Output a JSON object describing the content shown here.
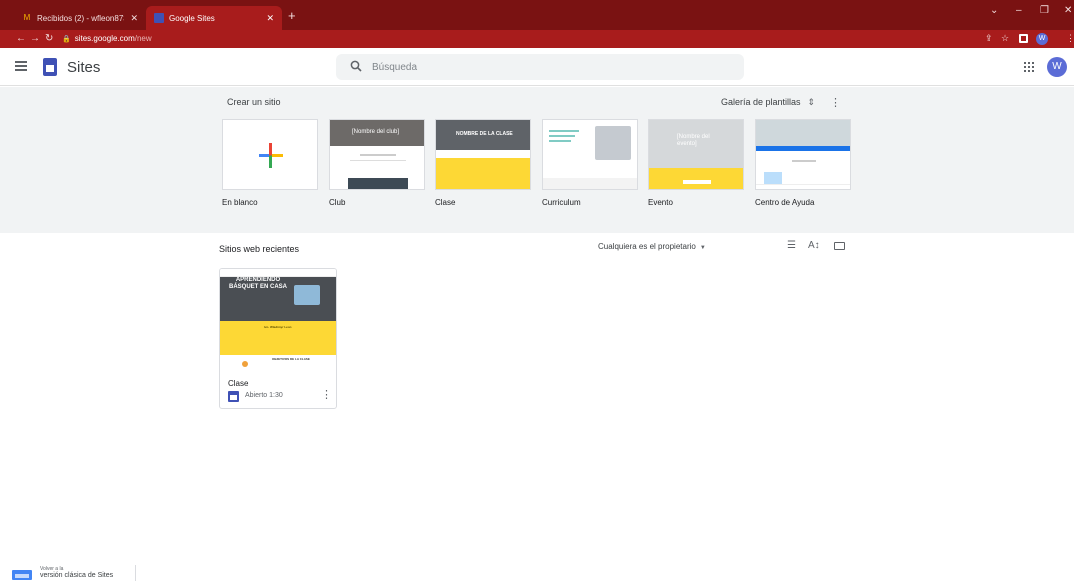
{
  "browser": {
    "tabs": [
      {
        "title": "Recibidos (2) - wfleon873@gmai",
        "icon": "gmail-icon"
      },
      {
        "title": "Google Sites",
        "icon": "sites-icon"
      }
    ],
    "url_host": "sites.google.com",
    "url_path": "/new",
    "profile_initial": "W",
    "theme_color": "#a81c1c"
  },
  "app": {
    "title": "Sites",
    "search_placeholder": "Búsqueda",
    "user_initial": "W",
    "accent": "#3f51b5"
  },
  "gallery": {
    "title": "Crear un sitio",
    "toggle_label": "Galería de plantillas",
    "templates": [
      {
        "label": "En blanco",
        "thumb_text": ""
      },
      {
        "label": "Club",
        "thumb_text": "[Nombre del club]"
      },
      {
        "label": "Clase",
        "thumb_text": "NOMBRE DE LA CLASE"
      },
      {
        "label": "Curriculum",
        "thumb_text": ""
      },
      {
        "label": "Evento",
        "thumb_text": "[Nombre del evento]"
      },
      {
        "label": "Centro de Ayuda",
        "thumb_text": ""
      }
    ]
  },
  "recent": {
    "title": "Sitios web recientes",
    "owner_filter": "Cualquiera es el propietario",
    "sites": [
      {
        "name": "Clase",
        "meta": "Abierto 1:30",
        "thumb_title": "APRENDIENDO BÁSQUET EN CASA",
        "thumb_subtitle": "Ivo. Wladimyr Leon",
        "thumb_section": "OBJETIVOS DE LA CLASE"
      }
    ]
  },
  "classic": {
    "line1": "Volver a la",
    "line2": "versión clásica de Sites"
  }
}
